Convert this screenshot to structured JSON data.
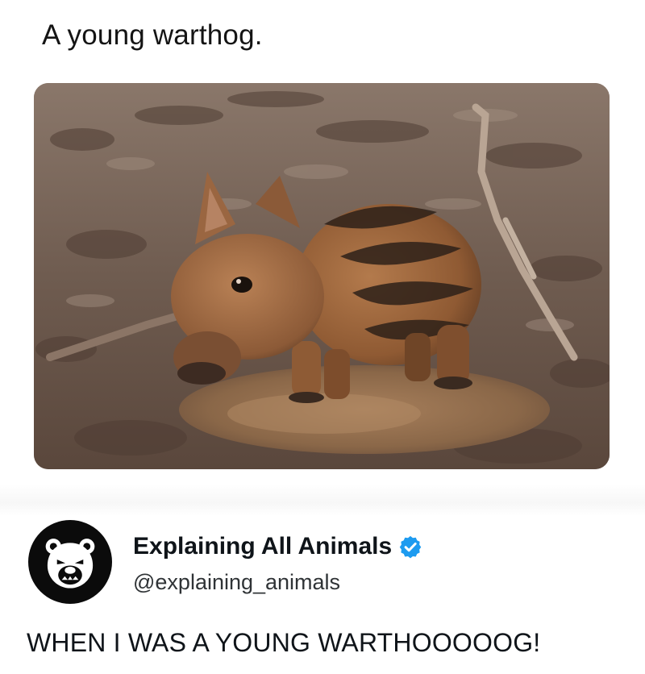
{
  "post": {
    "caption": "A young warthog.",
    "image_subject": "young-warthog-piglet-in-mud-puddle"
  },
  "tweet": {
    "display_name": "Explaining All Animals",
    "handle": "@explaining_animals",
    "verified": true,
    "verified_color": "#1d9bf0",
    "avatar_icon": "bear-face-icon",
    "text": "WHEN I WAS A YOUNG WARTHOOOOOG!"
  }
}
